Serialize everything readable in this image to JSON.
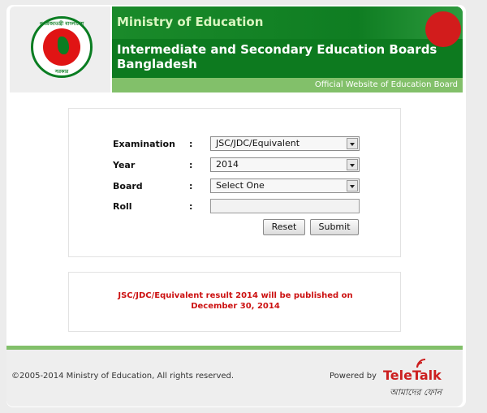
{
  "header": {
    "ministry": "Ministry of Education",
    "boards_line1": "Intermediate and Secondary Education Boards",
    "boards_line2": "Bangladesh",
    "subtitle": "Official Website of Education Board",
    "seal_top_text": "গণপ্রজাতন্ত্রী বাংলাদেশ",
    "seal_bottom_text": "সরকার"
  },
  "form": {
    "examination": {
      "label": "Examination",
      "colon": ":",
      "value": "JSC/JDC/Equivalent"
    },
    "year": {
      "label": "Year",
      "colon": ":",
      "value": "2014"
    },
    "board": {
      "label": "Board",
      "colon": ":",
      "value": "Select One"
    },
    "roll": {
      "label": "Roll",
      "colon": ":",
      "value": ""
    },
    "reset_label": "Reset",
    "submit_label": "Submit"
  },
  "notice": {
    "line1": "JSC/JDC/Equivalent result 2014 will be published on",
    "line2": "December 30, 2014"
  },
  "footer": {
    "copyright": "©2005-2014 Ministry of Education, All rights reserved.",
    "powered_by": "Powered by",
    "brand_tel": "Tele",
    "brand_talk": "Talk",
    "brand_tagline": "আমাদের ফোন"
  },
  "colors": {
    "header_green": "#0d7a1f",
    "subbar_green": "#82c06a",
    "notice_red": "#cc1111",
    "brand_red": "#cc1f1f"
  }
}
